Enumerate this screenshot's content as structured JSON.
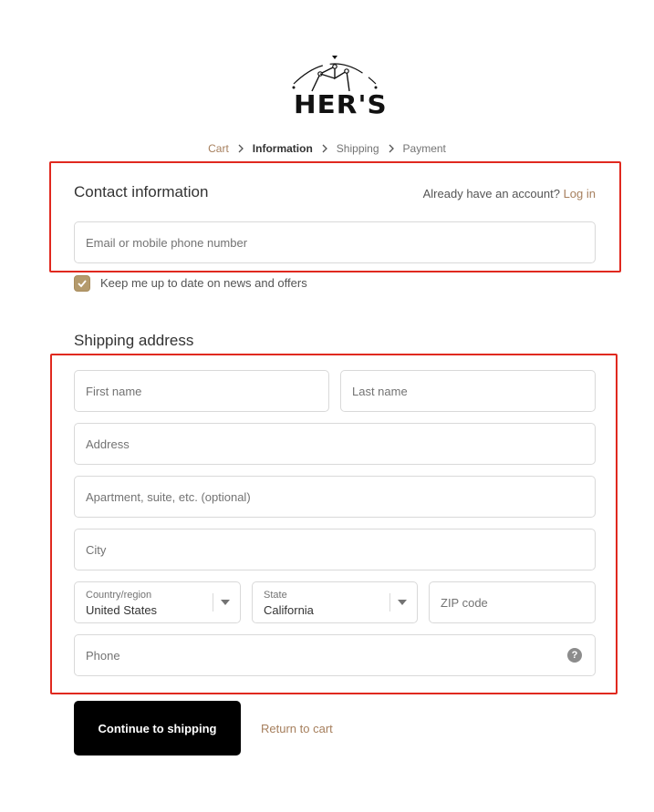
{
  "brand": {
    "logo_text": "HER'S"
  },
  "breadcrumb": [
    {
      "label": "Cart",
      "state": "link"
    },
    {
      "label": "Information",
      "state": "current"
    },
    {
      "label": "Shipping",
      "state": "upcoming"
    },
    {
      "label": "Payment",
      "state": "upcoming"
    }
  ],
  "contact": {
    "title": "Contact information",
    "account_prompt": "Already have an account?",
    "login_label": "Log in",
    "email_placeholder": "Email or mobile phone number",
    "newsletter_label": "Keep me up to date on news and offers",
    "newsletter_checked": true
  },
  "shipping": {
    "title": "Shipping address",
    "first_name_placeholder": "First name",
    "last_name_placeholder": "Last name",
    "address_placeholder": "Address",
    "apartment_placeholder": "Apartment, suite, etc. (optional)",
    "city_placeholder": "City",
    "country_label": "Country/region",
    "country_value": "United States",
    "state_label": "State",
    "state_value": "California",
    "zip_placeholder": "ZIP code",
    "phone_placeholder": "Phone",
    "help_glyph": "?"
  },
  "actions": {
    "continue_label": "Continue to shipping",
    "return_label": "Return to cart"
  },
  "colors": {
    "accent": "#a67f5d",
    "checkbox": "#b49a6c",
    "annotation": "#e0291f",
    "primary_button": "#000000"
  },
  "icons": [
    "crown-icon",
    "chevron-right-icon",
    "check-icon",
    "chevron-down-icon",
    "help-icon"
  ]
}
